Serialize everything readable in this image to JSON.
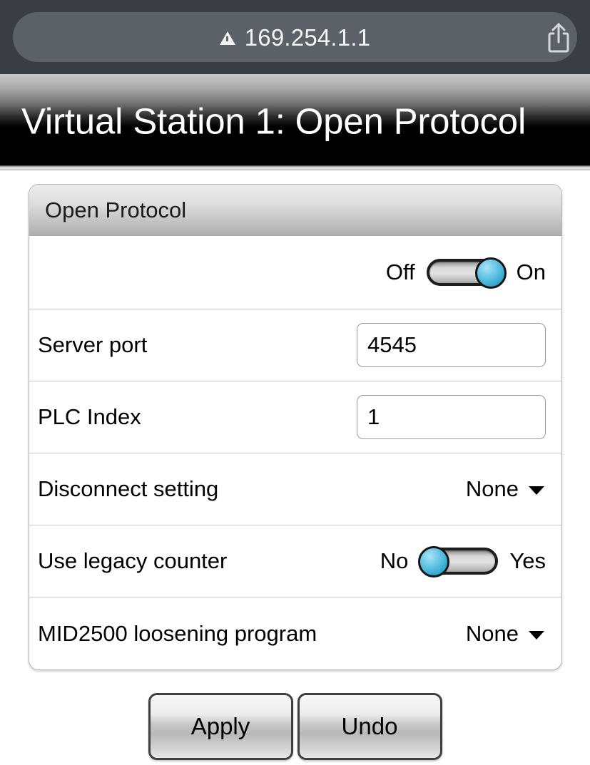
{
  "browser": {
    "url": "169.254.1.1",
    "warning_icon": "warning-triangle-icon",
    "share_icon": "share-icon"
  },
  "header": {
    "title": "Virtual Station 1: Open Protocol"
  },
  "panel": {
    "title": "Open Protocol",
    "rows": [
      {
        "type": "toggle",
        "label": "",
        "off_label": "Off",
        "on_label": "On",
        "state": "on"
      },
      {
        "type": "text",
        "label": "Server port",
        "value": "4545",
        "placeholder": ""
      },
      {
        "type": "text",
        "label": "PLC Index",
        "value": "1",
        "placeholder": ""
      },
      {
        "type": "select",
        "label": "Disconnect setting",
        "value": "None"
      },
      {
        "type": "toggle",
        "label": "Use legacy counter",
        "off_label": "No",
        "on_label": "Yes",
        "state": "off"
      },
      {
        "type": "select",
        "label": "MID2500 loosening program",
        "value": "None"
      }
    ]
  },
  "actions": {
    "apply_label": "Apply",
    "undo_label": "Undo"
  },
  "colors": {
    "accent_toggle": "#35aad4",
    "browser_bar": "#3a3d42",
    "url_pill": "#5c6067"
  }
}
